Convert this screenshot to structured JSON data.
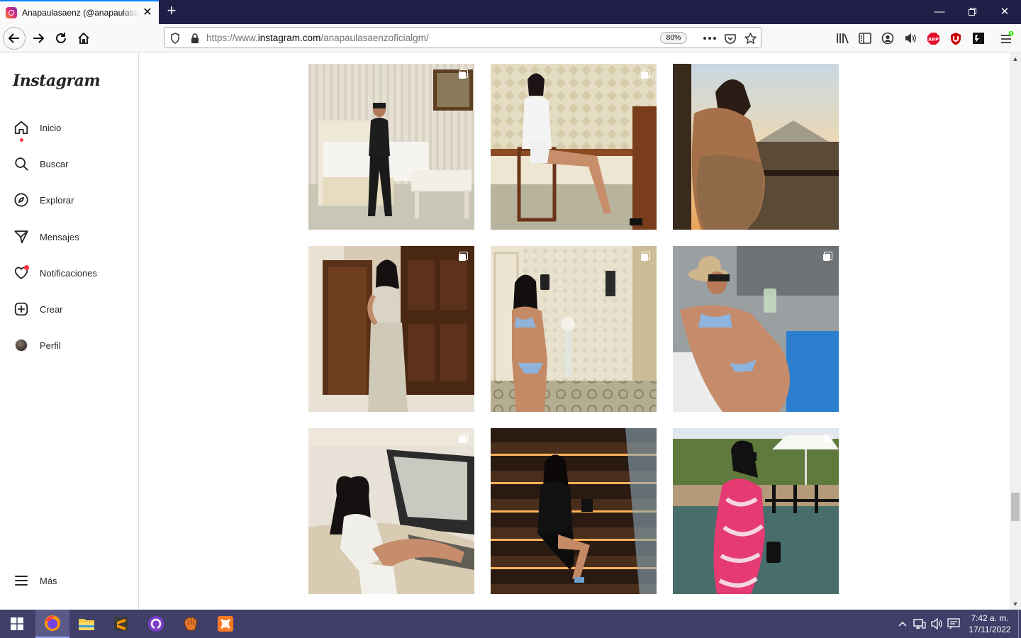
{
  "browser": {
    "tab_title": "Anapaulasaenz (@anapaulasaenzoficialgm)",
    "url_prefix": "https://www.",
    "url_domain": "instagram.com",
    "url_path": "/anapaulasaenzoficialgm/",
    "zoom": "80%"
  },
  "sidebar": {
    "logo": "Instagram",
    "items": [
      {
        "label": "Inicio",
        "icon": "home-icon"
      },
      {
        "label": "Buscar",
        "icon": "search-icon"
      },
      {
        "label": "Explorar",
        "icon": "compass-icon"
      },
      {
        "label": "Mensajes",
        "icon": "send-icon"
      },
      {
        "label": "Notificaciones",
        "icon": "heart-icon"
      },
      {
        "label": "Crear",
        "icon": "plus-square-icon"
      },
      {
        "label": "Perfil",
        "icon": "avatar"
      }
    ],
    "more_label": "Más"
  },
  "grid": {
    "posts": [
      {
        "alt": "woman in black jumpsuit in bedroom",
        "multi": true
      },
      {
        "alt": "woman in white blazer seated on chair",
        "multi": true
      },
      {
        "alt": "woman at balcony at sunset",
        "multi": false
      },
      {
        "alt": "woman in beige dress by wooden door",
        "multi": true
      },
      {
        "alt": "woman taking mirror selfie",
        "multi": true
      },
      {
        "alt": "woman in bikini on lounger",
        "multi": true
      },
      {
        "alt": "woman in white outfit in car",
        "multi": true
      },
      {
        "alt": "woman in black dress on lit stairs",
        "multi": false
      },
      {
        "alt": "woman in pink swirl dress by water",
        "multi": true
      }
    ]
  },
  "taskbar": {
    "time": "7:42 a. m.",
    "date": "17/11/2022"
  },
  "colors": {
    "instagram_text": "#262626",
    "notification_dot": "#ff3040",
    "taskbar": "#3f3f6a",
    "tabstrip": "#1f1f47"
  }
}
